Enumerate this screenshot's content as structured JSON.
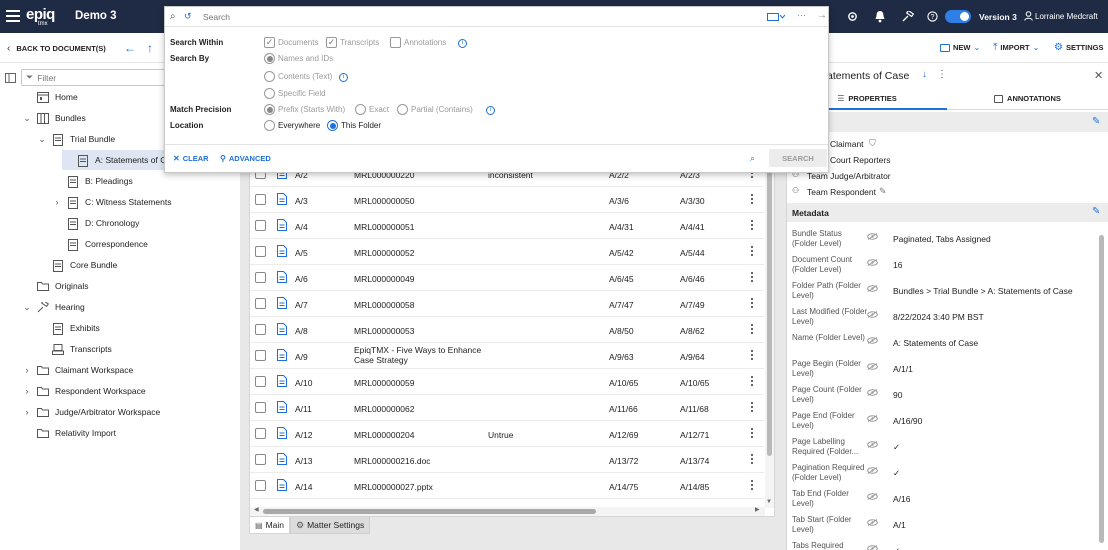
{
  "app": {
    "logo_main": "epiq",
    "logo_sub": "tmx",
    "matter": "Demo 3",
    "version_label": "Version 3",
    "user_name": "Lorraine Medcraft"
  },
  "toolbar": {
    "back_label": "BACK TO DOCUMENT(S)",
    "new_label": "NEW",
    "import_label": "IMPORT",
    "settings_label": "SETTINGS"
  },
  "search": {
    "placeholder": "Search",
    "within_label": "Search Within",
    "within_options": [
      {
        "label": "Documents",
        "checked": true
      },
      {
        "label": "Transcripts",
        "checked": true
      },
      {
        "label": "Annotations",
        "checked": false
      }
    ],
    "by_label": "Search By",
    "by_options": [
      {
        "label": "Names and IDs",
        "selected": true
      },
      {
        "label": "Contents (Text)",
        "selected": false
      },
      {
        "label": "Specific Field",
        "selected": false
      }
    ],
    "precision_label": "Match Precision",
    "precision_options": [
      {
        "label": "Prefix (Starts With)",
        "selected": true
      },
      {
        "label": "Exact",
        "selected": false
      },
      {
        "label": "Partial (Contains)",
        "selected": false
      }
    ],
    "location_label": "Location",
    "location_options": [
      {
        "label": "Everywhere",
        "selected": false
      },
      {
        "label": "This Folder",
        "selected": true
      }
    ],
    "clear_label": "CLEAR",
    "advanced_label": "ADVANCED",
    "search_button": "SEARCH"
  },
  "tree": {
    "filter_placeholder": "Filter",
    "items": [
      {
        "label": "Home",
        "icon": "home-icon"
      },
      {
        "label": "Bundles",
        "icon": "bundles-icon"
      },
      {
        "label": "Trial Bundle",
        "icon": "bundle-icon"
      },
      {
        "label": "A: Statements of Case",
        "icon": "folder-doc-icon"
      },
      {
        "label": "B: Pleadings",
        "icon": "folder-doc-icon"
      },
      {
        "label": "C: Witness Statements",
        "icon": "folder-doc-icon"
      },
      {
        "label": "D: Chronology",
        "icon": "folder-doc-icon"
      },
      {
        "label": "Correspondence",
        "icon": "folder-doc-icon"
      },
      {
        "label": "Core Bundle",
        "icon": "bundle-icon"
      },
      {
        "label": "Originals",
        "icon": "originals-icon"
      },
      {
        "label": "Hearing",
        "icon": "hearing-icon"
      },
      {
        "label": "Exhibits",
        "icon": "bundle-icon"
      },
      {
        "label": "Transcripts",
        "icon": "transcripts-icon"
      },
      {
        "label": "Claimant Workspace",
        "icon": "folder-icon"
      },
      {
        "label": "Respondent Workspace",
        "icon": "folder-icon"
      },
      {
        "label": "Judge/Arbitrator Workspace",
        "icon": "folder-icon"
      },
      {
        "label": "Relativity Import",
        "icon": "folder-icon"
      }
    ]
  },
  "grid": {
    "rows": [
      {
        "tab": "A/2",
        "doc_id": "MRL000000220",
        "note": "inconsistent",
        "begin": "A/2/2",
        "end": "A/2/3"
      },
      {
        "tab": "A/3",
        "doc_id": "MRL000000050",
        "note": "",
        "begin": "A/3/6",
        "end": "A/3/30"
      },
      {
        "tab": "A/4",
        "doc_id": "MRL000000051",
        "note": "",
        "begin": "A/4/31",
        "end": "A/4/41"
      },
      {
        "tab": "A/5",
        "doc_id": "MRL000000052",
        "note": "",
        "begin": "A/5/42",
        "end": "A/5/44"
      },
      {
        "tab": "A/6",
        "doc_id": "MRL000000049",
        "note": "",
        "begin": "A/6/45",
        "end": "A/6/46"
      },
      {
        "tab": "A/7",
        "doc_id": "MRL000000058",
        "note": "",
        "begin": "A/7/47",
        "end": "A/7/49"
      },
      {
        "tab": "A/8",
        "doc_id": "MRL000000053",
        "note": "",
        "begin": "A/8/50",
        "end": "A/8/62"
      },
      {
        "tab": "A/9",
        "doc_id": "EpiqTMX - Five Ways to Enhance Case Strategy",
        "note": "",
        "begin": "A/9/63",
        "end": "A/9/64"
      },
      {
        "tab": "A/10",
        "doc_id": "MRL000000059",
        "note": "",
        "begin": "A/10/65",
        "end": "A/10/65"
      },
      {
        "tab": "A/11",
        "doc_id": "MRL000000062",
        "note": "",
        "begin": "A/11/66",
        "end": "A/11/68"
      },
      {
        "tab": "A/12",
        "doc_id": "MRL000000204",
        "note": "Untrue",
        "begin": "A/12/69",
        "end": "A/12/71"
      },
      {
        "tab": "A/13",
        "doc_id": "MRL000000216.doc",
        "note": "",
        "begin": "A/13/72",
        "end": "A/13/74"
      },
      {
        "tab": "A/14",
        "doc_id": "MRL000000027.pptx",
        "note": "",
        "begin": "A/14/75",
        "end": "A/14/85"
      }
    ],
    "tabs": [
      {
        "label": "Main"
      },
      {
        "label": "Matter Settings"
      }
    ]
  },
  "details": {
    "title": "A: Statements of Case",
    "title_visible": "atements of Case",
    "tabs": [
      {
        "label": "PROPERTIES"
      },
      {
        "label": "ANNOTATIONS"
      }
    ],
    "share_header": "th",
    "share_items": [
      {
        "label": "Claimant"
      },
      {
        "label": "Court Reporters"
      },
      {
        "label": "Team Judge/Arbitrator"
      },
      {
        "label": "Team Respondent"
      }
    ],
    "metadata_header": "Metadata",
    "metadata": [
      {
        "label": "Bundle Status (Folder Level)",
        "value": "Paginated, Tabs Assigned"
      },
      {
        "label": "Document Count (Folder Level)",
        "value": "16"
      },
      {
        "label": "Folder Path (Folder Level)",
        "value": "Bundles > Trial Bundle > A: Statements of Case"
      },
      {
        "label": "Last Modified (Folder Level)",
        "value": "8/22/2024 3:40 PM BST"
      },
      {
        "label": "Name (Folder Level)",
        "value": "A: Statements of Case"
      },
      {
        "label": "Page Begin (Folder Level)",
        "value": "A/1/1"
      },
      {
        "label": "Page Count (Folder Level)",
        "value": "90"
      },
      {
        "label": "Page End (Folder Level)",
        "value": "A/16/90"
      },
      {
        "label": "Page Labelling Required (Folder...",
        "value": "✓"
      },
      {
        "label": "Pagination Required (Folder Level)",
        "value": "✓"
      },
      {
        "label": "Tab End (Folder Level)",
        "value": "A/16"
      },
      {
        "label": "Tab Start (Folder Level)",
        "value": "A/1"
      },
      {
        "label": "Tabs Required (Folder Level)",
        "value": "✓"
      }
    ]
  },
  "colors": {
    "topbar": "#1f2a44",
    "accent": "#1e6fd9",
    "selected_row": "#dde6f2"
  }
}
